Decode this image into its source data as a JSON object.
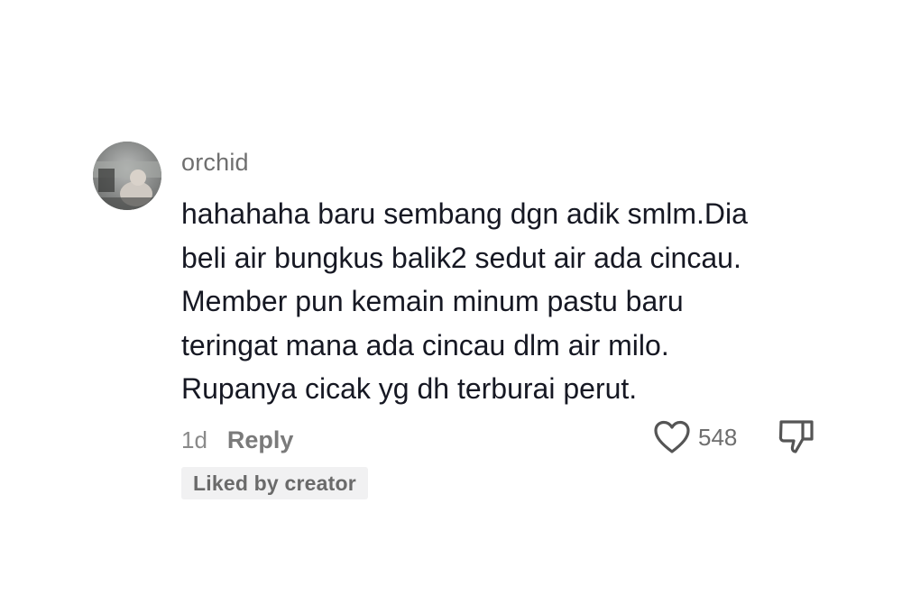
{
  "comment": {
    "username": "orchid",
    "body_lines": [
      "hahahaha baru sembang dgn adik smlm.Dia",
      "beli air bungkus balik2 sedut air ada cincau.",
      "Member pun kemain minum pastu baru",
      "teringat mana ada cincau dlm air milo.",
      "Rupanya cicak yg dh terburai perut."
    ],
    "timestamp": "1d",
    "reply_label": "Reply",
    "like_count": "548",
    "badge": "Liked by creator",
    "icons": {
      "like": "heart-outline-icon",
      "dislike": "thumbs-down-icon"
    },
    "colors": {
      "text": "#161823",
      "muted": "#6f6f6f",
      "badge_bg": "#f1f1f2"
    }
  }
}
